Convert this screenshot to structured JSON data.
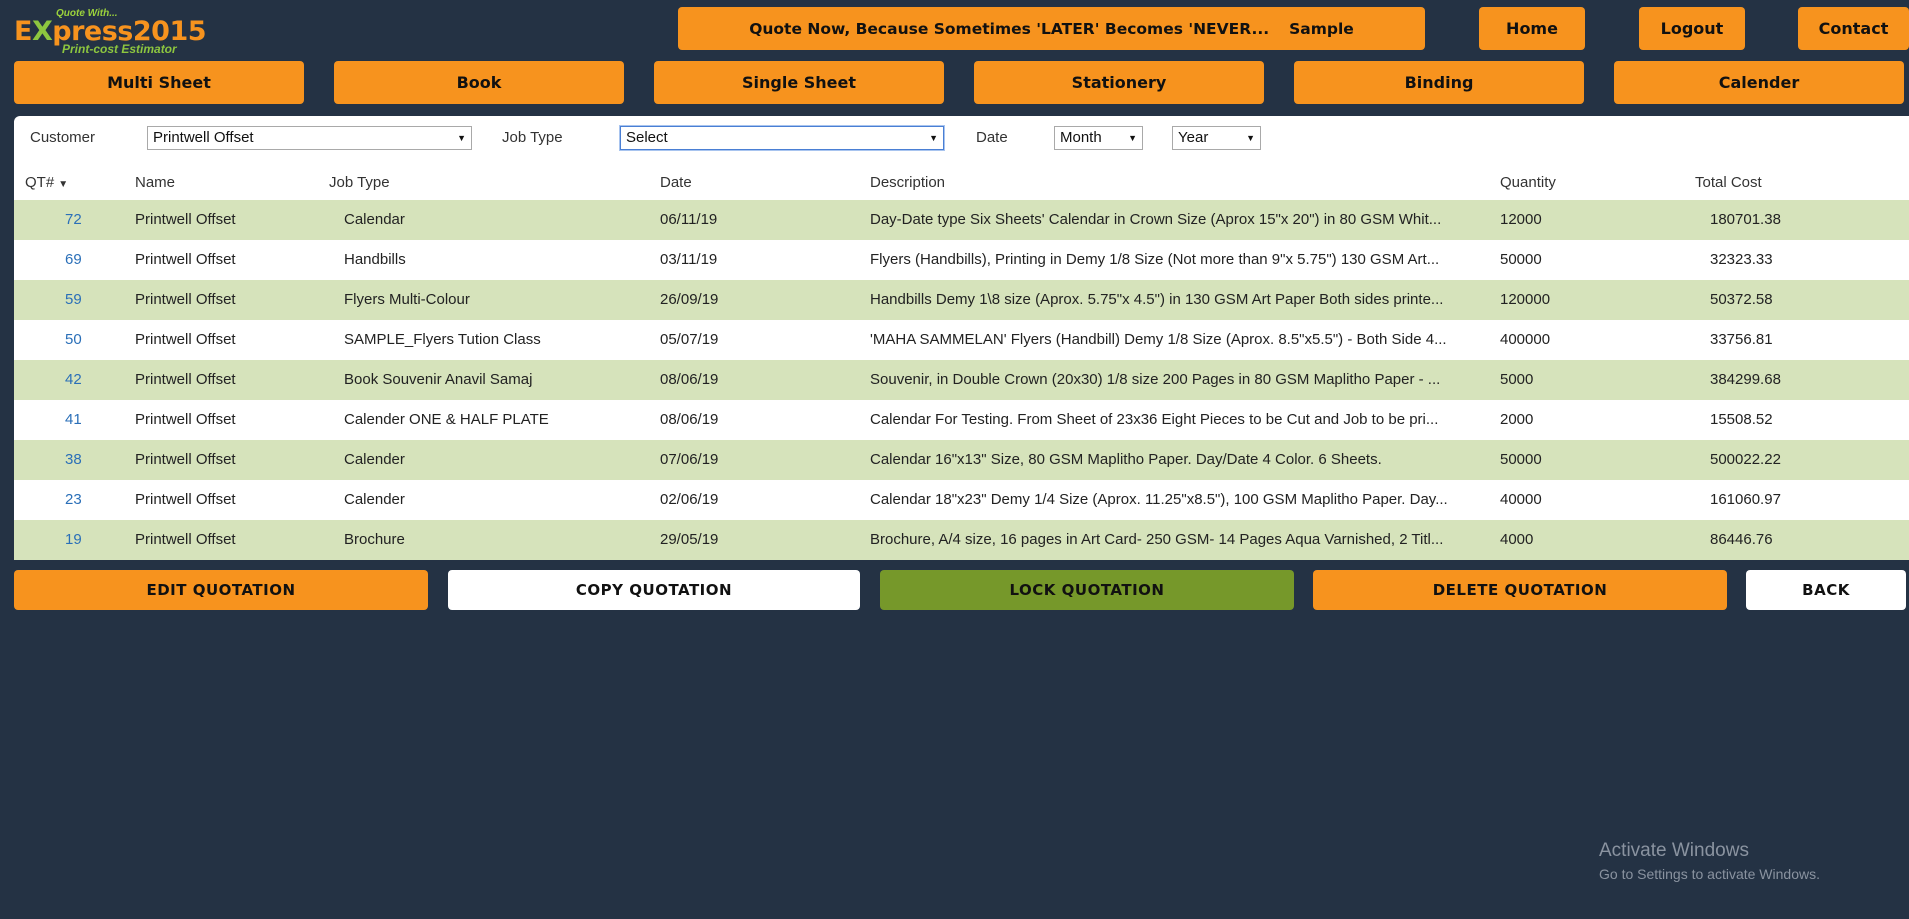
{
  "logo": {
    "tagline": "Quote With...",
    "brand_prefix": "E",
    "brand_x": "X",
    "brand_suffix": "press2015",
    "subtitle": "Print-cost Estimator"
  },
  "header": {
    "banner": "Quote Now, Because Sometimes 'LATER' Becomes 'NEVER...",
    "banner_suffix": "Sample",
    "nav": [
      "Home",
      "Logout",
      "Contact"
    ]
  },
  "tabs": [
    "Multi Sheet",
    "Book",
    "Single Sheet",
    "Stationery",
    "Binding",
    "Calender"
  ],
  "filters": {
    "customer_label": "Customer",
    "customer_value": "Printwell Offset",
    "jobtype_label": "Job Type",
    "jobtype_value": "Select",
    "date_label": "Date",
    "month_value": "Month",
    "year_value": "Year"
  },
  "table": {
    "columns": [
      "QT#",
      "Name",
      "Job Type",
      "Date",
      "Description",
      "Quantity",
      "Total Cost"
    ],
    "rows": [
      {
        "qt": "72",
        "name": "Printwell Offset",
        "job": "Calendar",
        "date": "06/11/19",
        "desc": "Day-Date type Six Sheets' Calendar in Crown Size (Aprox 15\"x 20\") in 80 GSM Whit...",
        "qty": "12000",
        "cost": "180701.38"
      },
      {
        "qt": "69",
        "name": "Printwell Offset",
        "job": "Handbills",
        "date": "03/11/19",
        "desc": "Flyers (Handbills), Printing in Demy 1/8 Size (Not more than 9\"x 5.75\") 130 GSM Art...",
        "qty": "50000",
        "cost": "32323.33"
      },
      {
        "qt": "59",
        "name": "Printwell Offset",
        "job": "Flyers Multi-Colour",
        "date": "26/09/19",
        "desc": "Handbills Demy 1\\8 size (Aprox. 5.75\"x 4.5\") in 130 GSM Art Paper Both sides printe...",
        "qty": "120000",
        "cost": "50372.58"
      },
      {
        "qt": "50",
        "name": "Printwell Offset",
        "job": "SAMPLE_Flyers Tution Class",
        "date": "05/07/19",
        "desc": "'MAHA SAMMELAN' Flyers (Handbill) Demy 1/8 Size (Aprox. 8.5\"x5.5\") - Both Side 4...",
        "qty": "400000",
        "cost": "33756.81"
      },
      {
        "qt": "42",
        "name": "Printwell Offset",
        "job": "Book Souvenir Anavil Samaj",
        "date": "08/06/19",
        "desc": "Souvenir, in Double Crown (20x30) 1/8 size 200 Pages in 80 GSM Maplitho Paper - ...",
        "qty": "5000",
        "cost": "384299.68"
      },
      {
        "qt": "41",
        "name": "Printwell Offset",
        "job": "Calender ONE & HALF PLATE",
        "date": "08/06/19",
        "desc": "Calendar For Testing. From Sheet of 23x36 Eight Pieces to be Cut and Job to be pri...",
        "qty": "2000",
        "cost": "15508.52"
      },
      {
        "qt": "38",
        "name": "Printwell Offset",
        "job": "Calender",
        "date": "07/06/19",
        "desc": "Calendar 16\"x13\" Size, 80 GSM Maplitho Paper. Day/Date 4 Color. 6 Sheets.",
        "qty": "50000",
        "cost": "500022.22"
      },
      {
        "qt": "23",
        "name": "Printwell Offset",
        "job": "Calender",
        "date": "02/06/19",
        "desc": "Calendar 18\"x23\" Demy 1/4 Size (Aprox. 11.25\"x8.5\"), 100 GSM Maplitho Paper. Day...",
        "qty": "40000",
        "cost": "161060.97"
      },
      {
        "qt": "19",
        "name": "Printwell Offset",
        "job": "Brochure",
        "date": "29/05/19",
        "desc": "Brochure, A/4 size, 16 pages in Art Card- 250 GSM- 14 Pages Aqua Varnished, 2 Titl...",
        "qty": "4000",
        "cost": "86446.76"
      }
    ]
  },
  "actions": [
    "EDIT QUOTATION",
    "COPY QUOTATION",
    "LOCK QUOTATION",
    "DELETE QUOTATION",
    "BACK"
  ],
  "watermark": {
    "line1": "Activate Windows",
    "line2": "Go to Settings to activate Windows."
  },
  "colors": {
    "background": "#243244",
    "accent_orange": "#f7931e",
    "row_alt": "#d6e3bb",
    "lock_green": "#76982a",
    "link_blue": "#2a6fb8"
  }
}
